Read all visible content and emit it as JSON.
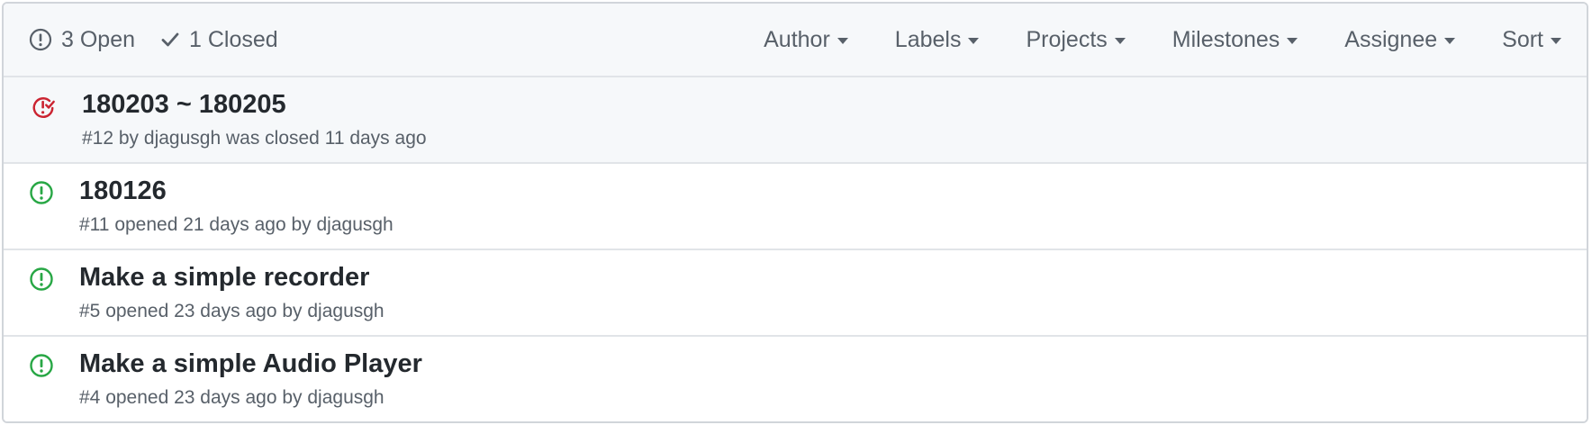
{
  "header": {
    "open_label": "3 Open",
    "closed_label": "1 Closed",
    "filters": [
      "Author",
      "Labels",
      "Projects",
      "Milestones",
      "Assignee",
      "Sort"
    ]
  },
  "colors": {
    "open": "#28a745",
    "closed": "#cb2431",
    "muted": "#586069"
  },
  "issues": [
    {
      "title": "180203 ~ 180205",
      "state": "closed",
      "meta_prefix": "#12 by ",
      "author": "djagusgh",
      "meta_suffix": " was closed 11 days ago"
    },
    {
      "title": "180126",
      "state": "open",
      "meta_prefix": "#11 opened 21 days ago by ",
      "author": "djagusgh",
      "meta_suffix": ""
    },
    {
      "title": "Make a simple recorder",
      "state": "open",
      "meta_prefix": "#5 opened 23 days ago by ",
      "author": "djagusgh",
      "meta_suffix": ""
    },
    {
      "title": "Make a simple Audio Player",
      "state": "open",
      "meta_prefix": "#4 opened 23 days ago by ",
      "author": "djagusgh",
      "meta_suffix": ""
    }
  ]
}
